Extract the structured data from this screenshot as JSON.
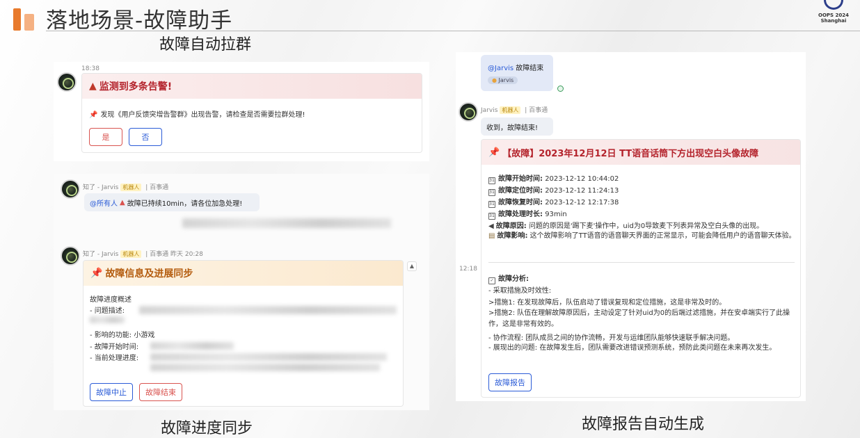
{
  "header": {
    "title": "落地场景-故障助手",
    "logo_line1": "OOPS 2024",
    "logo_line2": "Shanghai",
    "accent_colors": [
      "#e87a2c",
      "#f5b183"
    ]
  },
  "sections": {
    "auto_group": "故障自动拉群",
    "progress_sync": "故障进度同步",
    "report_gen": "故障报告自动生成"
  },
  "alert_card": {
    "time": "18:38",
    "title": "监测到多条告警!",
    "message": "发现《用户反馈突增告警群》出现告警，请检查是否需要拉群处理!",
    "yes_label": "是",
    "no_label": "否"
  },
  "urge_message": {
    "sender": "知了 - Jarvis",
    "bot_tag": "机器人",
    "org": "百事通",
    "mention": "@所有人",
    "text": "故障已持续10min，请各位加急处理!"
  },
  "progress_card": {
    "sender": "知了 - Jarvis",
    "bot_tag": "机器人",
    "org": "百事通",
    "time": "昨天 20:28",
    "title": "故障信息及进展同步",
    "overview": "故障进度概述",
    "issue_desc": "- 问题描述:",
    "affected": "- 影响的功能: 小游戏",
    "start_time": "- 故障开始时间:",
    "current_progress": "- 当前处理进度:",
    "stop_label": "故障中止",
    "end_label": "故障结束"
  },
  "report_panel": {
    "user_msg_mention": "@Jarvis",
    "user_msg_text": "故障结束",
    "user_tag": "Jarvis",
    "sender": "Jarvis",
    "bot_tag": "机器人",
    "org": "百事通",
    "reply": "收到，故障结束!",
    "side_time": "12:18",
    "report_title": "【故障】2023年12月12日 TT语音话筒下方出现空白头像故障",
    "rows": [
      {
        "label": "故障开始时间:",
        "value": "2023-12-12 10:44:02"
      },
      {
        "label": "故障定位时间:",
        "value": "2023-12-12 11:24:13"
      },
      {
        "label": "故障恢复时间:",
        "value": "2023-12-12 12:17:38"
      },
      {
        "label": "故障处理时长:",
        "value": "93min"
      }
    ],
    "cause_label": "故障原因:",
    "cause_text": "问题的原因是'踢下麦'操作中，uid为0导致麦下列表异常及空白头像的出现。",
    "impact_label": "故障影响:",
    "impact_text": "这个故障影响了TT语音的语音聊天界面的正常显示，可能会降低用户的语音聊天体验。",
    "analysis_label": "故障分析:",
    "analysis_lines": [
      "- 采取措施及时效性:",
      ">措施1: 在发现故障后，队伍启动了错误复现和定位措施，这是非常及时的。",
      ">措施2: 队伍在理解故障原因后，主动设定了针对uid为0的后端过滤措施，并在安卓端实行了此操作，这是非常有效的。",
      "- 协作流程: 团队成员之间的协作流畅，开发与运维团队能够快速联手解决问题。",
      "- 展现出的问题: 在故障发生后，团队需要改进错误预测系统，预防此类问题在未来再次发生。"
    ],
    "report_button": "故障报告"
  }
}
